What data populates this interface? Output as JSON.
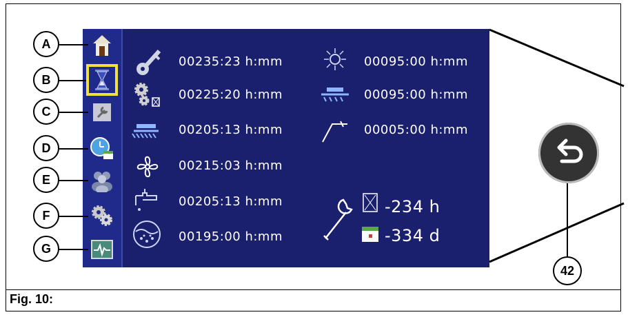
{
  "callouts": [
    "A",
    "B",
    "C",
    "D",
    "E",
    "F",
    "G"
  ],
  "sidebar_icons": [
    "home-icon",
    "hourglass-icon",
    "wrench-icon",
    "clock-calendar-icon",
    "users-icon",
    "gears-icon",
    "monitor-pulse-icon"
  ],
  "selected_index": 1,
  "left_rows": [
    {
      "icon": "key-icon",
      "value": "00235:23 h:mm"
    },
    {
      "icon": "gears-hourglass-icon",
      "value": "00225:20 h:mm"
    },
    {
      "icon": "brush-deck-icon",
      "value": "00205:13 h:mm"
    },
    {
      "icon": "fan-icon",
      "value": "00215:03 h:mm"
    },
    {
      "icon": "water-tap-icon",
      "value": "00205:13 h:mm"
    },
    {
      "icon": "tank-icon",
      "value": "00195:00 h:mm"
    }
  ],
  "right_rows": [
    {
      "icon": "side-brush-icon",
      "value": "00095:00 h:mm"
    },
    {
      "icon": "squeegee-icon",
      "value": "00095:00 h:mm"
    },
    {
      "icon": "wand-icon",
      "value": "00005:00 h:mm"
    }
  ],
  "service": {
    "hours": "-234 h",
    "days": "-334 d"
  },
  "back_callout": "42",
  "caption": "Fig. 10:",
  "colors": {
    "screen": "#1a1f6e",
    "sidebar": "#1f2a8a",
    "highlight": "#f0e23a"
  }
}
